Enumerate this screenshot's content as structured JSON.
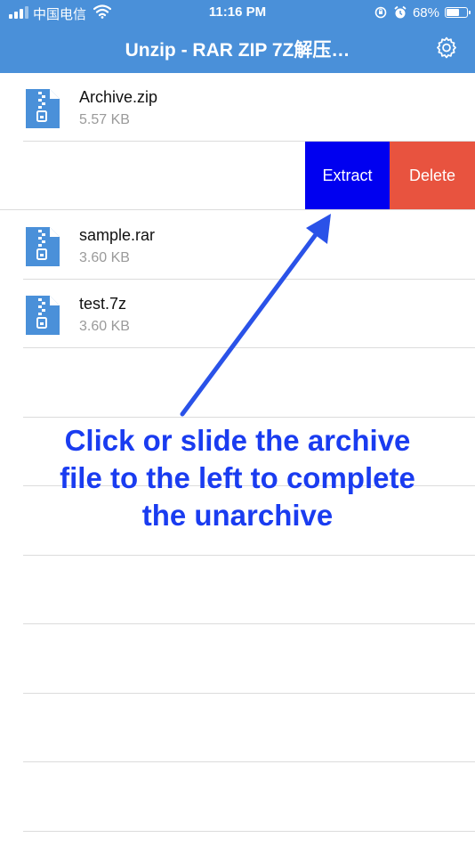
{
  "status_bar": {
    "carrier": "中国电信",
    "time": "11:16 PM",
    "battery": "68%",
    "battery_level": 0.68,
    "signal_bars_active": 3,
    "signal_bars_total": 4,
    "icons": [
      "signal-icon",
      "wifi-icon",
      "orientation-lock-icon",
      "alarm-icon",
      "battery-icon"
    ]
  },
  "nav": {
    "title": "Unzip - RAR ZIP 7Z解压…",
    "settings_icon": "gear-icon"
  },
  "files": [
    {
      "name": "Archive.zip",
      "size": "5.57 KB",
      "icon": "zip-file-icon"
    },
    {
      "name": "sample.rar",
      "size": "3.60 KB",
      "icon": "zip-file-icon"
    },
    {
      "name": "test.7z",
      "size": "3.60 KB",
      "icon": "zip-file-icon"
    }
  ],
  "swipe_actions": {
    "extract": "Extract",
    "delete": "Delete"
  },
  "overlay": {
    "instruction_lines": [
      "Click or slide the archive",
      "file to the left to complete",
      "the unarchive"
    ]
  },
  "colors": {
    "nav_bar": "#4a90d9",
    "extract_button": "#0000f0",
    "delete_button": "#e8533f",
    "instruction_text": "#1a3cf0",
    "arrow": "#2a52e8",
    "file_icon": "#4a90d9"
  }
}
